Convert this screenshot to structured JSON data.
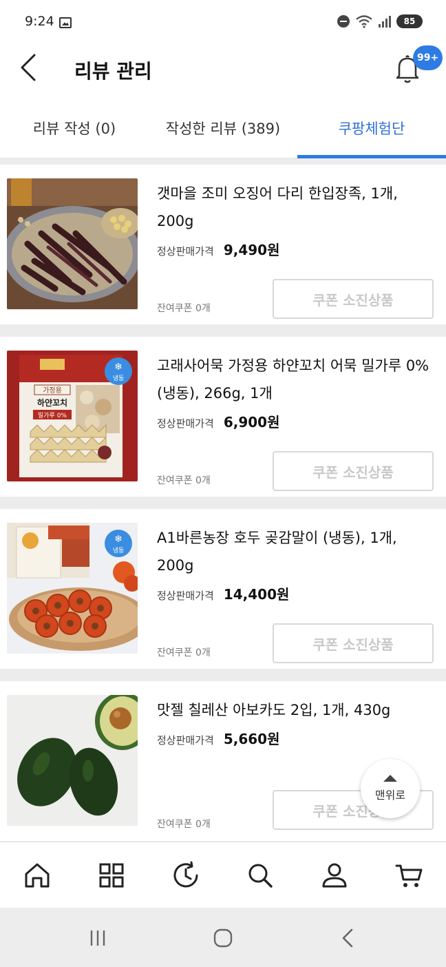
{
  "status": {
    "time": "9:24",
    "battery": "85"
  },
  "header": {
    "title": "리뷰 관리",
    "notification_badge": "99+"
  },
  "tabs": [
    {
      "label": "리뷰 작성 (0)"
    },
    {
      "label": "작성한 리뷰 (389)"
    },
    {
      "label": "쿠팡체험단",
      "active": true
    }
  ],
  "products": [
    {
      "name": "갯마을 조미 오징어 다리 한입장족, 1개, 200g",
      "price_label": "정상판매가격",
      "price": "9,490원",
      "coupon_text": "잔여쿠폰 0개",
      "button_label": "쿠폰 소진상품"
    },
    {
      "name": "고래사어묵 가정용 하얀꼬치 어묵 밀가루 0% (냉동), 266g, 1개",
      "price_label": "정상판매가격",
      "price": "6,900원",
      "coupon_text": "잔여쿠폰 0개",
      "button_label": "쿠폰 소진상품",
      "thumb_text": {
        "badge": "냉동",
        "package": "가정용",
        "package2": "하얀꼬치",
        "package3": "밀가루 0%"
      }
    },
    {
      "name": "A1바른농장 호두 곶감말이 (냉동), 1개, 200g",
      "price_label": "정상판매가격",
      "price": "14,400원",
      "coupon_text": "잔여쿠폰 0개",
      "button_label": "쿠폰 소진상품",
      "thumb_text": {
        "badge": "냉동"
      }
    },
    {
      "name": "맛젤 칠레산 아보카도 2입, 1개, 430g",
      "price_label": "정상판매가격",
      "price": "5,660원",
      "coupon_text": "잔여쿠폰 0개",
      "button_label": "쿠폰 소진상품"
    }
  ],
  "top_button": {
    "label": "맨위로"
  },
  "bottom_nav": [
    "home-icon",
    "category-grid-icon",
    "recent-history-icon",
    "search-icon",
    "my-account-icon",
    "cart-icon"
  ],
  "colors": {
    "accent": "#2f7be4",
    "disabled_text": "#c8c8c8"
  }
}
